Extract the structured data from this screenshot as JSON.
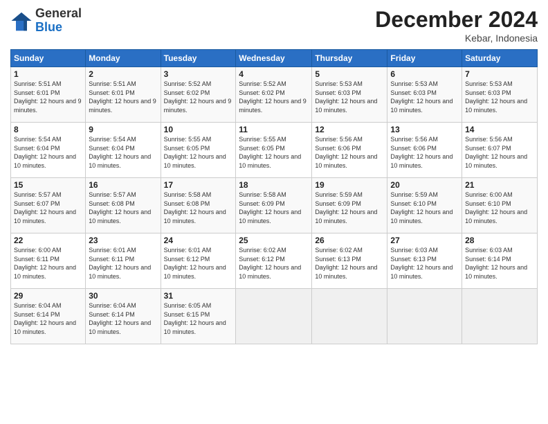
{
  "logo": {
    "general": "General",
    "blue": "Blue"
  },
  "title": "December 2024",
  "location": "Kebar, Indonesia",
  "days_of_week": [
    "Sunday",
    "Monday",
    "Tuesday",
    "Wednesday",
    "Thursday",
    "Friday",
    "Saturday"
  ],
  "weeks": [
    [
      {
        "day": "1",
        "sunrise": "5:51 AM",
        "sunset": "6:01 PM",
        "daylight": "12 hours and 9 minutes."
      },
      {
        "day": "2",
        "sunrise": "5:51 AM",
        "sunset": "6:01 PM",
        "daylight": "12 hours and 9 minutes."
      },
      {
        "day": "3",
        "sunrise": "5:52 AM",
        "sunset": "6:02 PM",
        "daylight": "12 hours and 9 minutes."
      },
      {
        "day": "4",
        "sunrise": "5:52 AM",
        "sunset": "6:02 PM",
        "daylight": "12 hours and 9 minutes."
      },
      {
        "day": "5",
        "sunrise": "5:53 AM",
        "sunset": "6:03 PM",
        "daylight": "12 hours and 10 minutes."
      },
      {
        "day": "6",
        "sunrise": "5:53 AM",
        "sunset": "6:03 PM",
        "daylight": "12 hours and 10 minutes."
      },
      {
        "day": "7",
        "sunrise": "5:53 AM",
        "sunset": "6:03 PM",
        "daylight": "12 hours and 10 minutes."
      }
    ],
    [
      {
        "day": "8",
        "sunrise": "5:54 AM",
        "sunset": "6:04 PM",
        "daylight": "12 hours and 10 minutes."
      },
      {
        "day": "9",
        "sunrise": "5:54 AM",
        "sunset": "6:04 PM",
        "daylight": "12 hours and 10 minutes."
      },
      {
        "day": "10",
        "sunrise": "5:55 AM",
        "sunset": "6:05 PM",
        "daylight": "12 hours and 10 minutes."
      },
      {
        "day": "11",
        "sunrise": "5:55 AM",
        "sunset": "6:05 PM",
        "daylight": "12 hours and 10 minutes."
      },
      {
        "day": "12",
        "sunrise": "5:56 AM",
        "sunset": "6:06 PM",
        "daylight": "12 hours and 10 minutes."
      },
      {
        "day": "13",
        "sunrise": "5:56 AM",
        "sunset": "6:06 PM",
        "daylight": "12 hours and 10 minutes."
      },
      {
        "day": "14",
        "sunrise": "5:56 AM",
        "sunset": "6:07 PM",
        "daylight": "12 hours and 10 minutes."
      }
    ],
    [
      {
        "day": "15",
        "sunrise": "5:57 AM",
        "sunset": "6:07 PM",
        "daylight": "12 hours and 10 minutes."
      },
      {
        "day": "16",
        "sunrise": "5:57 AM",
        "sunset": "6:08 PM",
        "daylight": "12 hours and 10 minutes."
      },
      {
        "day": "17",
        "sunrise": "5:58 AM",
        "sunset": "6:08 PM",
        "daylight": "12 hours and 10 minutes."
      },
      {
        "day": "18",
        "sunrise": "5:58 AM",
        "sunset": "6:09 PM",
        "daylight": "12 hours and 10 minutes."
      },
      {
        "day": "19",
        "sunrise": "5:59 AM",
        "sunset": "6:09 PM",
        "daylight": "12 hours and 10 minutes."
      },
      {
        "day": "20",
        "sunrise": "5:59 AM",
        "sunset": "6:10 PM",
        "daylight": "12 hours and 10 minutes."
      },
      {
        "day": "21",
        "sunrise": "6:00 AM",
        "sunset": "6:10 PM",
        "daylight": "12 hours and 10 minutes."
      }
    ],
    [
      {
        "day": "22",
        "sunrise": "6:00 AM",
        "sunset": "6:11 PM",
        "daylight": "12 hours and 10 minutes."
      },
      {
        "day": "23",
        "sunrise": "6:01 AM",
        "sunset": "6:11 PM",
        "daylight": "12 hours and 10 minutes."
      },
      {
        "day": "24",
        "sunrise": "6:01 AM",
        "sunset": "6:12 PM",
        "daylight": "12 hours and 10 minutes."
      },
      {
        "day": "25",
        "sunrise": "6:02 AM",
        "sunset": "6:12 PM",
        "daylight": "12 hours and 10 minutes."
      },
      {
        "day": "26",
        "sunrise": "6:02 AM",
        "sunset": "6:13 PM",
        "daylight": "12 hours and 10 minutes."
      },
      {
        "day": "27",
        "sunrise": "6:03 AM",
        "sunset": "6:13 PM",
        "daylight": "12 hours and 10 minutes."
      },
      {
        "day": "28",
        "sunrise": "6:03 AM",
        "sunset": "6:14 PM",
        "daylight": "12 hours and 10 minutes."
      }
    ],
    [
      {
        "day": "29",
        "sunrise": "6:04 AM",
        "sunset": "6:14 PM",
        "daylight": "12 hours and 10 minutes."
      },
      {
        "day": "30",
        "sunrise": "6:04 AM",
        "sunset": "6:14 PM",
        "daylight": "12 hours and 10 minutes."
      },
      {
        "day": "31",
        "sunrise": "6:05 AM",
        "sunset": "6:15 PM",
        "daylight": "12 hours and 10 minutes."
      },
      null,
      null,
      null,
      null
    ]
  ]
}
